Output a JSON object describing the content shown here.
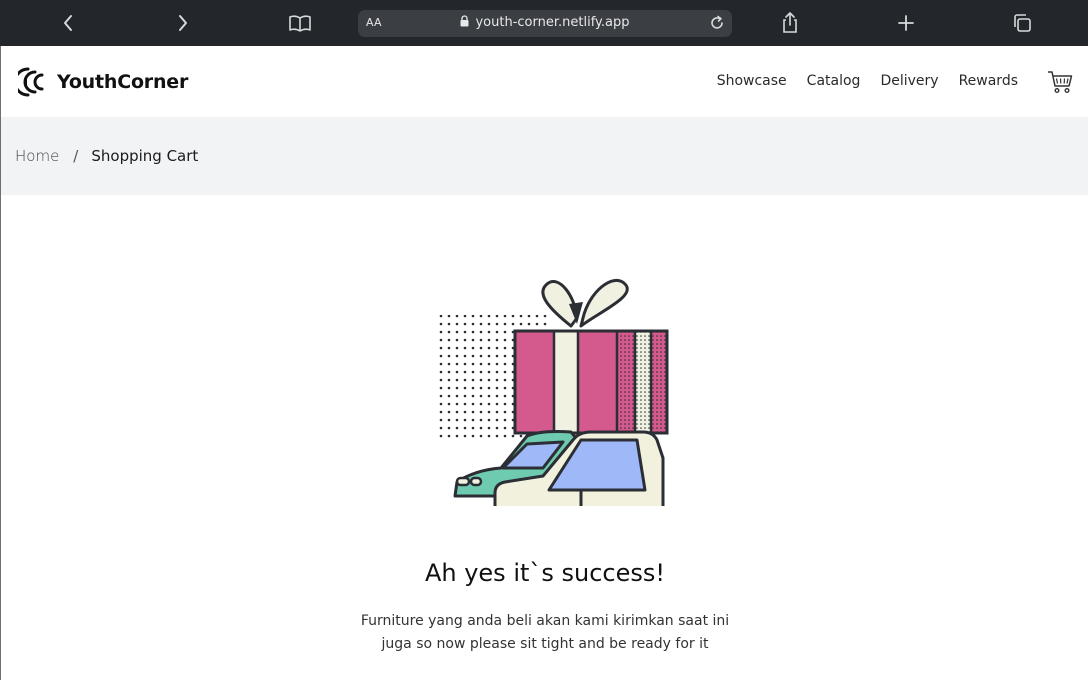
{
  "browser": {
    "url": "youth-corner.netlify.app",
    "text_size_label": "AA",
    "buttons": [
      "back",
      "forward",
      "reader-mode",
      "share",
      "new-tab",
      "tabs"
    ]
  },
  "site": {
    "brand": "YouthCorner",
    "nav": [
      "Showcase",
      "Catalog",
      "Delivery",
      "Rewards"
    ],
    "breadcrumb": {
      "home": "Home",
      "separator": "/",
      "current": "Shopping Cart"
    },
    "success": {
      "title": "Ah yes it`s success!",
      "description_line1": "Furniture yang anda beli akan kami kirimkan saat ini",
      "description_line2": "juga so now please sit tight and be ready for it"
    }
  },
  "colors": {
    "gift_pink": "#d4598d",
    "ribbon_cream": "#f0f1e1",
    "car_cream": "#f2f1dd",
    "car_green": "#6ecbb0",
    "window_blue": "#9fb8f7",
    "outline": "#2b2e34"
  }
}
